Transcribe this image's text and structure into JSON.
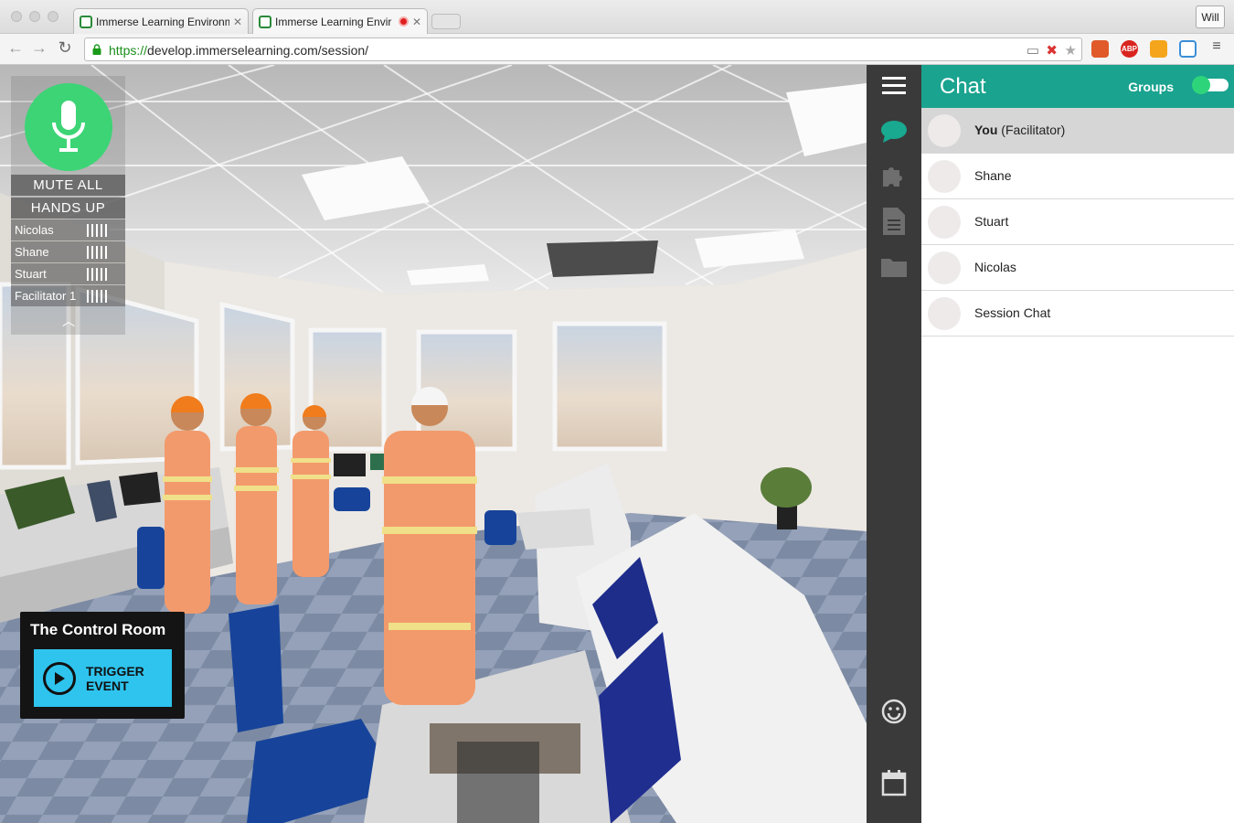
{
  "browser": {
    "tabs": [
      {
        "title": "Immerse Learning Environm",
        "active": false,
        "recording": false
      },
      {
        "title": "Immerse Learning Envir",
        "active": true,
        "recording": true
      }
    ],
    "user_button": "Will",
    "url_scheme": "https://",
    "url_rest": "develop.immerselearning.com/session/",
    "extensions": [
      "bookmark-icon",
      "adblock-icon",
      "analytics-icon",
      "cast-icon"
    ],
    "extension_labels": {
      "adblock": "ABP"
    }
  },
  "voice": {
    "mic_state": "on",
    "mute_all_label": "MUTE ALL",
    "hands_up_label": "HANDS UP",
    "participants": [
      {
        "name": "Nicolas"
      },
      {
        "name": "Shane"
      },
      {
        "name": "Stuart"
      },
      {
        "name": "Facilitator 1"
      }
    ]
  },
  "room": {
    "title": "The Control Room",
    "trigger_line1": "TRIGGER",
    "trigger_line2": "EVENT"
  },
  "rail": {
    "items": [
      "menu-icon",
      "chat-icon",
      "puzzle-icon",
      "document-icon",
      "folder-icon",
      "emoji-icon",
      "calendar-icon"
    ],
    "active": "chat-icon"
  },
  "chat": {
    "title": "Chat",
    "groups_label": "Groups",
    "groups_enabled": true,
    "contacts": [
      {
        "name": "You",
        "role": " (Facilitator)",
        "selected": true
      },
      {
        "name": "Shane",
        "role": "",
        "selected": false
      },
      {
        "name": "Stuart",
        "role": "",
        "selected": false
      },
      {
        "name": "Nicolas",
        "role": "",
        "selected": false
      },
      {
        "name": "Session Chat",
        "role": "",
        "selected": false
      }
    ]
  },
  "colors": {
    "chat_header": "#1aa38f",
    "mic_green": "#3dd476",
    "trigger_blue": "#2ec4ee",
    "rail_dark": "#3a3a3a",
    "chat_active_icon": "#19a890"
  }
}
